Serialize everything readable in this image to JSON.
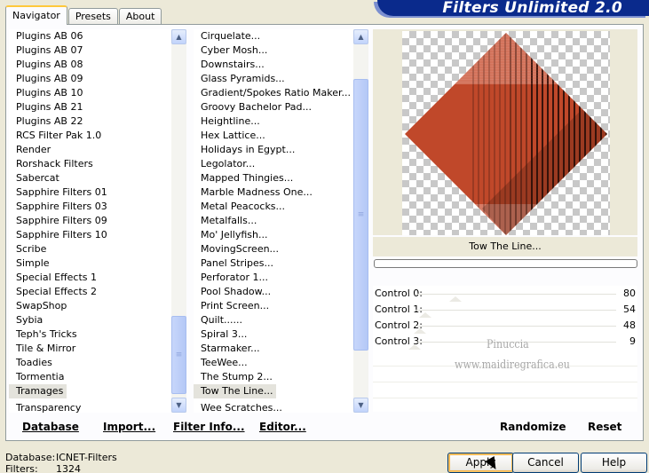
{
  "tabs": [
    {
      "label": "Navigator",
      "active": true
    },
    {
      "label": "Presets",
      "active": false
    },
    {
      "label": "About",
      "active": false
    }
  ],
  "banner": "Filters Unlimited 2.0",
  "categories": {
    "items": [
      "Plugins AB 06",
      "Plugins AB 07",
      "Plugins AB 08",
      "Plugins AB 09",
      "Plugins AB 10",
      "Plugins AB 21",
      "Plugins AB 22",
      "RCS Filter Pak 1.0",
      "Render",
      "Rorshack Filters",
      "Sabercat",
      "Sapphire Filters 01",
      "Sapphire Filters 03",
      "Sapphire Filters 09",
      "Sapphire Filters 10",
      "Scribe",
      "Simple",
      "Special Effects 1",
      "Special Effects 2",
      "SwapShop",
      "Sybia",
      "Teph's Tricks",
      "Tile & Mirror",
      "Toadies",
      "Tormentia",
      "Tramages",
      "Transparency"
    ],
    "selected": "Tramages"
  },
  "filters": {
    "items": [
      "Cirquelate...",
      "Cyber Mosh...",
      "Downstairs...",
      "Glass Pyramids...",
      "Gradient/Spokes Ratio Maker...",
      "Groovy Bachelor Pad...",
      "Heightline...",
      "Hex Lattice...",
      "Holidays in Egypt...",
      "Legolator...",
      "Mapped Thingies...",
      "Marble Madness One...",
      "Metal Peacocks...",
      "Metalfalls...",
      "Mo' Jellyfish...",
      "MovingScreen...",
      "Panel Stripes...",
      "Perforator 1...",
      "Pool Shadow...",
      "Print Screen...",
      "Quilt......",
      "Spiral 3...",
      "Starmaker...",
      "TeeWee...",
      "The Stump 2...",
      "Tow The Line...",
      "Wee Scratches..."
    ],
    "selected": "Tow The Line..."
  },
  "preview": {
    "filter_name": "Tow The Line...",
    "colors": {
      "diamond": "#c0482a",
      "stripe": "#2a0e08",
      "light": "#e9a898"
    }
  },
  "controls": [
    {
      "label": "Control 0:",
      "value": 80
    },
    {
      "label": "Control 1:",
      "value": 54
    },
    {
      "label": "Control 2:",
      "value": 48
    },
    {
      "label": "Control 3:",
      "value": 9
    }
  ],
  "watermark": {
    "line1": "Pinuccia",
    "line2": "www.maidiregrafica.eu"
  },
  "toolbar": {
    "database": "Database",
    "import": "Import...",
    "filter_info": "Filter Info...",
    "editor": "Editor...",
    "randomize": "Randomize",
    "reset": "Reset"
  },
  "status": {
    "database_label": "Database:",
    "database_value": "ICNET-Filters",
    "filters_label": "Filters:",
    "filters_value": "1324"
  },
  "buttons": {
    "apply": "Apply",
    "cancel": "Cancel",
    "help": "Help"
  }
}
